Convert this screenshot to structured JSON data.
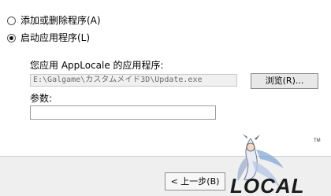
{
  "options": {
    "add_remove_label": "添加或删除程序(A)",
    "start_app_label": "启动应用程序(L)",
    "selected": "start_app"
  },
  "app_path": {
    "label": "您应用 AppLocale 的应用程序:",
    "value": "E:\\Galgame\\カスタムメイド3D\\Update.exe",
    "browse_label": "浏览(R)..."
  },
  "params": {
    "label": "参数:",
    "value": ""
  },
  "footer": {
    "back_label": "< 上一步(B)",
    "logo_text": "LOCAL",
    "logo_mark": "TM"
  }
}
